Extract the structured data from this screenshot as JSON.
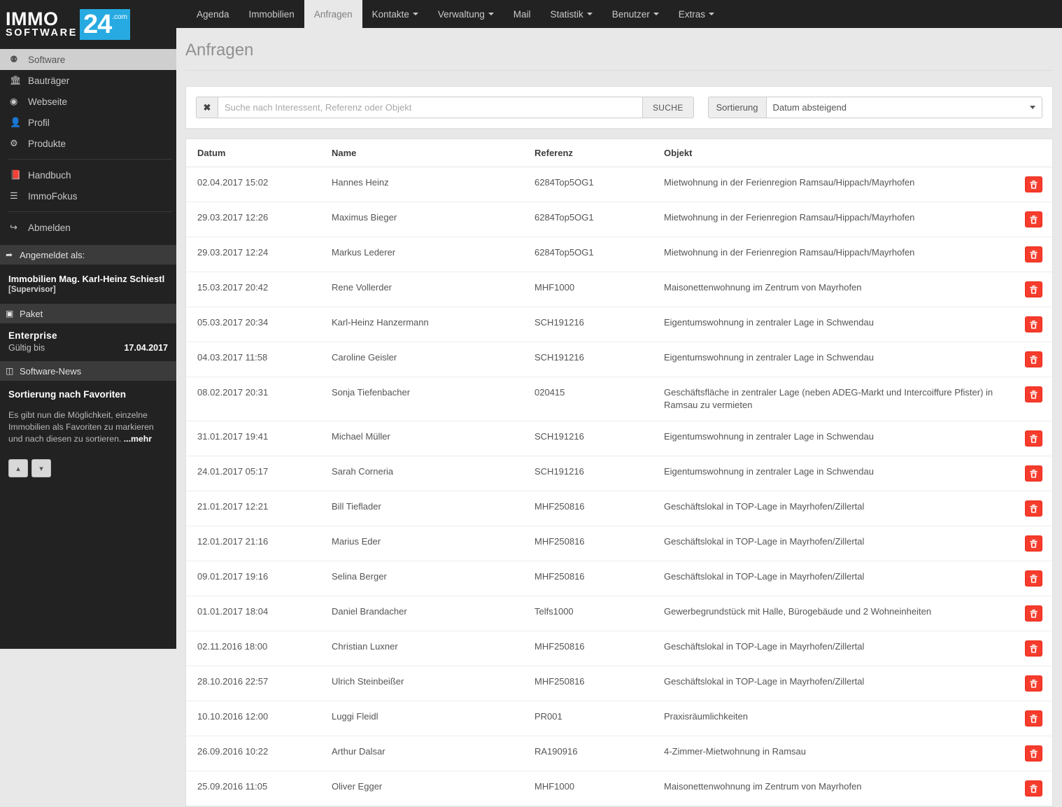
{
  "brand": {
    "immo": "IMMO",
    "software": "SOFTWARE",
    "twentyfour": "24",
    "com": ".com",
    "accent": "#27aae1"
  },
  "topnav": {
    "items": [
      {
        "label": "Agenda",
        "caret": false,
        "active": false
      },
      {
        "label": "Immobilien",
        "caret": false,
        "active": false
      },
      {
        "label": "Anfragen",
        "caret": false,
        "active": true
      },
      {
        "label": "Kontakte",
        "caret": true,
        "active": false
      },
      {
        "label": "Verwaltung",
        "caret": true,
        "active": false
      },
      {
        "label": "Mail",
        "caret": false,
        "active": false
      },
      {
        "label": "Statistik",
        "caret": true,
        "active": false
      },
      {
        "label": "Benutzer",
        "caret": true,
        "active": false
      },
      {
        "label": "Extras",
        "caret": true,
        "active": false
      }
    ]
  },
  "sidebar": {
    "items": [
      {
        "label": "Software",
        "icon": "dashboard-icon",
        "glyph": "⚉",
        "active": true
      },
      {
        "label": "Bauträger",
        "icon": "bank-icon",
        "glyph": "🏛",
        "active": false
      },
      {
        "label": "Webseite",
        "icon": "globe-icon",
        "glyph": "◉",
        "active": false
      },
      {
        "label": "Profil",
        "icon": "user-icon",
        "glyph": "👤",
        "active": false
      },
      {
        "label": "Produkte",
        "icon": "cubes-icon",
        "glyph": "⚙",
        "active": false
      }
    ],
    "items2": [
      {
        "label": "Handbuch",
        "icon": "book-icon",
        "glyph": "📕",
        "active": false
      },
      {
        "label": "ImmoFokus",
        "icon": "list-icon",
        "glyph": "☰",
        "active": false
      }
    ],
    "items3": [
      {
        "label": "Abmelden",
        "icon": "logout-icon",
        "glyph": "↪",
        "active": false
      }
    ],
    "logged_in_header": "Angemeldet als:",
    "logged_in_icon": "signin-icon",
    "user_name": "Immobilien Mag. Karl-Heinz Schiestl",
    "user_role": "[Supervisor]",
    "paket_header": "Paket",
    "paket_icon": "box-icon",
    "paket_name": "Enterprise",
    "paket_valid_label": "Gültig bis",
    "paket_valid_date": "17.04.2017",
    "news_header": "Software-News",
    "news_icon": "news-icon",
    "news_title": "Sortierung nach Favoriten",
    "news_text": "Es gibt nun die Möglichkeit, einzelne Immobilien als Favoriten zu markieren und nach diesen zu sortieren. ",
    "news_more": "...mehr",
    "news_prev_icon": "chevron-up-icon",
    "news_next_icon": "chevron-down-icon"
  },
  "page": {
    "title": "Anfragen"
  },
  "filter": {
    "clear_label": "✖",
    "search_placeholder": "Suche nach Interessent, Referenz oder Objekt",
    "search_value": "",
    "search_button": "SUCHE",
    "sort_label": "Sortierung",
    "sort_value": "Datum absteigend"
  },
  "table": {
    "columns": [
      "Datum",
      "Name",
      "Referenz",
      "Objekt"
    ],
    "delete_icon": "trash-icon",
    "rows": [
      {
        "datum": "02.04.2017 15:02",
        "name": "Hannes Heinz",
        "referenz": "6284Top5OG1",
        "objekt": "Mietwohnung in der Ferienregion Ramsau/Hippach/Mayrhofen"
      },
      {
        "datum": "29.03.2017 12:26",
        "name": "Maximus Bieger",
        "referenz": "6284Top5OG1",
        "objekt": "Mietwohnung in der Ferienregion Ramsau/Hippach/Mayrhofen"
      },
      {
        "datum": "29.03.2017 12:24",
        "name": "Markus Lederer",
        "referenz": "6284Top5OG1",
        "objekt": "Mietwohnung in der Ferienregion Ramsau/Hippach/Mayrhofen"
      },
      {
        "datum": "15.03.2017 20:42",
        "name": "Rene Vollerder",
        "referenz": "MHF1000",
        "objekt": "Maisonettenwohnung im Zentrum von Mayrhofen"
      },
      {
        "datum": "05.03.2017 20:34",
        "name": "Karl-Heinz Hanzermann",
        "referenz": "SCH191216",
        "objekt": "Eigentumswohnung in zentraler Lage in Schwendau"
      },
      {
        "datum": "04.03.2017 11:58",
        "name": "Caroline Geisler",
        "referenz": "SCH191216",
        "objekt": "Eigentumswohnung in zentraler Lage in Schwendau"
      },
      {
        "datum": "08.02.2017 20:31",
        "name": "Sonja Tiefenbacher",
        "referenz": "020415",
        "objekt": "Geschäftsfläche in zentraler Lage (neben ADEG-Markt und Intercoiffure Pfister) in Ramsau zu vermieten"
      },
      {
        "datum": "31.01.2017 19:41",
        "name": "Michael Müller",
        "referenz": "SCH191216",
        "objekt": "Eigentumswohnung in zentraler Lage in Schwendau"
      },
      {
        "datum": "24.01.2017 05:17",
        "name": "Sarah Corneria",
        "referenz": "SCH191216",
        "objekt": "Eigentumswohnung in zentraler Lage in Schwendau"
      },
      {
        "datum": "21.01.2017 12:21",
        "name": "Bill Tieflader",
        "referenz": "MHF250816",
        "objekt": "Geschäftslokal in TOP-Lage in Mayrhofen/Zillertal"
      },
      {
        "datum": "12.01.2017 21:16",
        "name": "Marius Eder",
        "referenz": "MHF250816",
        "objekt": "Geschäftslokal in TOP-Lage in Mayrhofen/Zillertal"
      },
      {
        "datum": "09.01.2017 19:16",
        "name": "Selina Berger",
        "referenz": "MHF250816",
        "objekt": "Geschäftslokal in TOP-Lage in Mayrhofen/Zillertal"
      },
      {
        "datum": "01.01.2017 18:04",
        "name": "Daniel Brandacher",
        "referenz": "Telfs1000",
        "objekt": "Gewerbegrundstück mit Halle, Bürogebäude und 2 Wohneinheiten"
      },
      {
        "datum": "02.11.2016 18:00",
        "name": "Christian Luxner",
        "referenz": "MHF250816",
        "objekt": "Geschäftslokal in TOP-Lage in Mayrhofen/Zillertal"
      },
      {
        "datum": "28.10.2016 22:57",
        "name": "Ulrich Steinbeißer",
        "referenz": "MHF250816",
        "objekt": "Geschäftslokal in TOP-Lage in Mayrhofen/Zillertal"
      },
      {
        "datum": "10.10.2016 12:00",
        "name": "Luggi Fleidl",
        "referenz": "PR001",
        "objekt": "Praxisräumlichkeiten"
      },
      {
        "datum": "26.09.2016 10:22",
        "name": "Arthur Dalsar",
        "referenz": "RA190916",
        "objekt": "4-Zimmer-Mietwohnung in Ramsau"
      },
      {
        "datum": "25.09.2016 11:05",
        "name": "Oliver Egger",
        "referenz": "MHF1000",
        "objekt": "Maisonettenwohnung im Zentrum von Mayrhofen"
      }
    ]
  }
}
